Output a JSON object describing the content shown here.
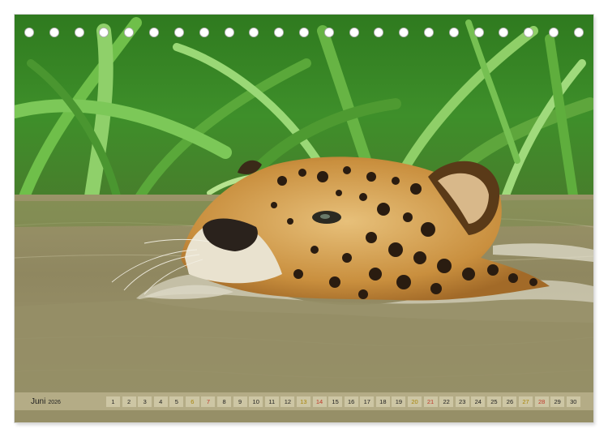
{
  "calendar": {
    "month": "Juni",
    "year": "2026",
    "days": [
      {
        "n": "1",
        "kind": "weekday"
      },
      {
        "n": "2",
        "kind": "weekday"
      },
      {
        "n": "3",
        "kind": "weekday"
      },
      {
        "n": "4",
        "kind": "weekday"
      },
      {
        "n": "5",
        "kind": "weekday"
      },
      {
        "n": "6",
        "kind": "sat"
      },
      {
        "n": "7",
        "kind": "sun"
      },
      {
        "n": "8",
        "kind": "weekday"
      },
      {
        "n": "9",
        "kind": "weekday"
      },
      {
        "n": "10",
        "kind": "weekday"
      },
      {
        "n": "11",
        "kind": "weekday"
      },
      {
        "n": "12",
        "kind": "weekday"
      },
      {
        "n": "13",
        "kind": "sat"
      },
      {
        "n": "14",
        "kind": "sun"
      },
      {
        "n": "15",
        "kind": "weekday"
      },
      {
        "n": "16",
        "kind": "weekday"
      },
      {
        "n": "17",
        "kind": "weekday"
      },
      {
        "n": "18",
        "kind": "weekday"
      },
      {
        "n": "19",
        "kind": "weekday"
      },
      {
        "n": "20",
        "kind": "sat"
      },
      {
        "n": "21",
        "kind": "sun"
      },
      {
        "n": "22",
        "kind": "weekday"
      },
      {
        "n": "23",
        "kind": "weekday"
      },
      {
        "n": "24",
        "kind": "weekday"
      },
      {
        "n": "25",
        "kind": "weekday"
      },
      {
        "n": "26",
        "kind": "weekday"
      },
      {
        "n": "27",
        "kind": "sat"
      },
      {
        "n": "28",
        "kind": "sun"
      },
      {
        "n": "29",
        "kind": "weekday"
      },
      {
        "n": "30",
        "kind": "weekday"
      }
    ]
  },
  "binding": {
    "hole_count": 23
  },
  "colors": {
    "saturday": "#a8860a",
    "sunday": "#c0392b",
    "text": "#222222"
  }
}
